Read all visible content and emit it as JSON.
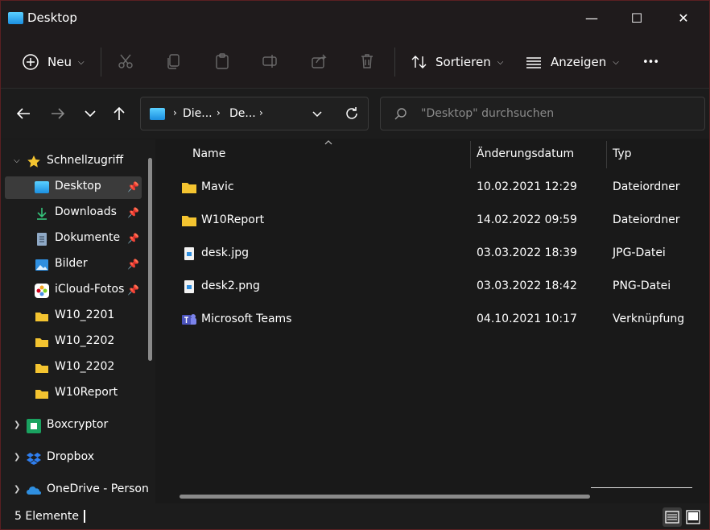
{
  "window": {
    "title": "Desktop",
    "minimize": "—",
    "maximize": "☐",
    "close": "✕"
  },
  "toolbar": {
    "new_label": "Neu",
    "sort_label": "Sortieren",
    "view_label": "Anzeigen",
    "more_label": "•••"
  },
  "address": {
    "crumbs": [
      "Die...",
      "De..."
    ],
    "sep": "›"
  },
  "search": {
    "placeholder": "\"Desktop\" durchsuchen"
  },
  "sidebar": {
    "quick_access": "Schnellzugriff",
    "items": [
      {
        "label": "Desktop",
        "icon": "desktop-icon",
        "pinned": true,
        "selected": true
      },
      {
        "label": "Downloads",
        "icon": "download-icon",
        "pinned": true
      },
      {
        "label": "Dokumente",
        "icon": "document-icon",
        "pinned": true
      },
      {
        "label": "Bilder",
        "icon": "pictures-icon",
        "pinned": true
      },
      {
        "label": "iCloud-Fotos",
        "icon": "icloud-photos-icon",
        "pinned": true
      },
      {
        "label": "W10_2201",
        "icon": "folder-icon"
      },
      {
        "label": "W10_2202",
        "icon": "folder-icon"
      },
      {
        "label": "W10_2202",
        "icon": "folder-icon"
      },
      {
        "label": "W10Report",
        "icon": "folder-icon"
      }
    ],
    "roots": [
      {
        "label": "Boxcryptor",
        "icon": "boxcryptor-icon"
      },
      {
        "label": "Dropbox",
        "icon": "dropbox-icon"
      },
      {
        "label": "OneDrive - Person",
        "icon": "onedrive-icon"
      }
    ]
  },
  "table": {
    "headers": {
      "name": "Name",
      "date": "Änderungsdatum",
      "type": "Typ"
    },
    "rows": [
      {
        "name": "Mavic",
        "date": "10.02.2021 12:29",
        "type": "Dateiordner",
        "icon": "folder-icon"
      },
      {
        "name": "W10Report",
        "date": "14.02.2022 09:59",
        "type": "Dateiordner",
        "icon": "folder-icon"
      },
      {
        "name": "desk.jpg",
        "date": "03.03.2022 18:39",
        "type": "JPG-Datei",
        "icon": "image-file-icon"
      },
      {
        "name": "desk2.png",
        "date": "03.03.2022 18:42",
        "type": "PNG-Datei",
        "icon": "image-file-icon"
      },
      {
        "name": "Microsoft Teams",
        "date": "04.10.2021 10:17",
        "type": "Verknüpfung",
        "icon": "teams-icon"
      }
    ]
  },
  "status": {
    "count": "5 Elemente"
  },
  "colors": {
    "folder": "#f4c430",
    "accent": "#1c8fe0",
    "border": "#5a1f22"
  }
}
